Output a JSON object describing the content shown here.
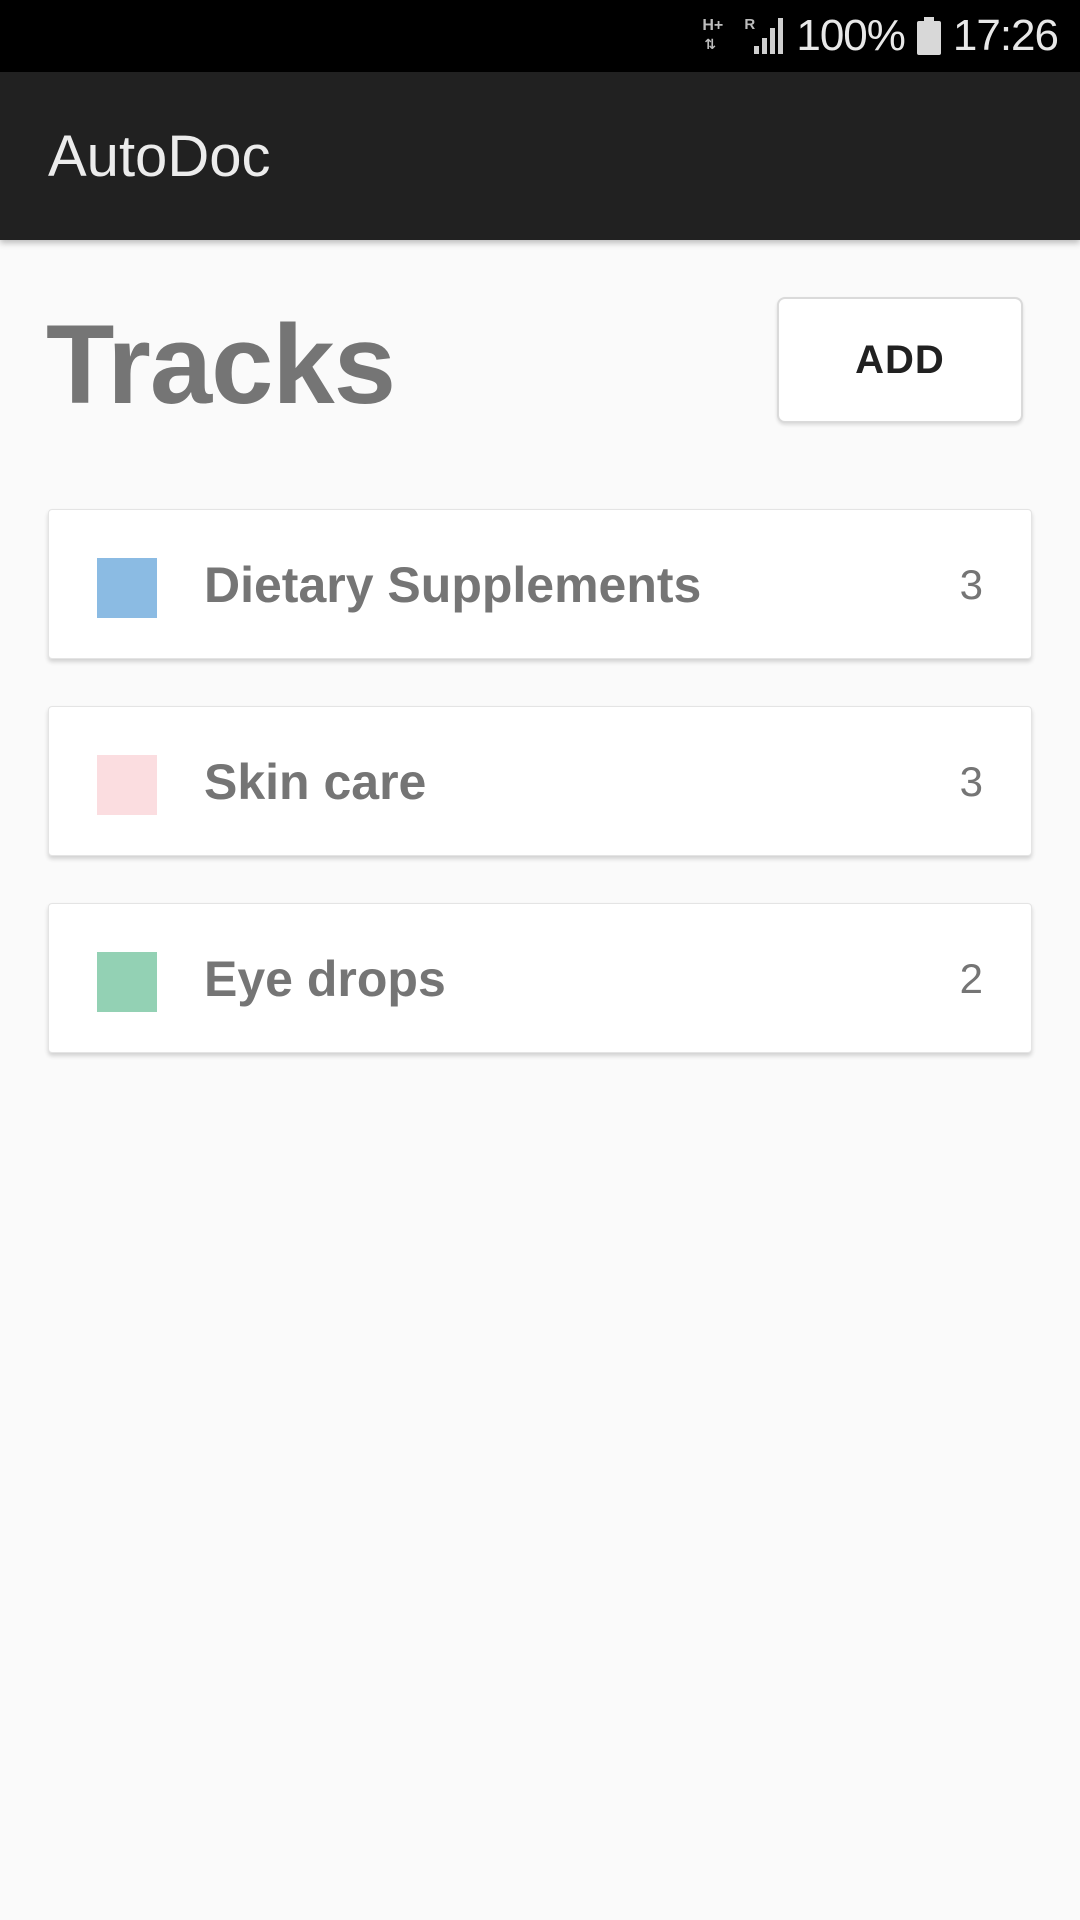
{
  "status_bar": {
    "network_type": "H+",
    "roaming": "R",
    "battery": "100%",
    "time": "17:26"
  },
  "app_bar": {
    "title": "AutoDoc"
  },
  "main": {
    "title": "Tracks",
    "add_label": "ADD",
    "tracks": [
      {
        "name": "Dietary Supplements",
        "count": "3",
        "color": "#8bbbe3"
      },
      {
        "name": "Skin care",
        "count": "3",
        "color": "#fbdde0"
      },
      {
        "name": "Eye drops",
        "count": "2",
        "color": "#93d1b4"
      }
    ]
  }
}
